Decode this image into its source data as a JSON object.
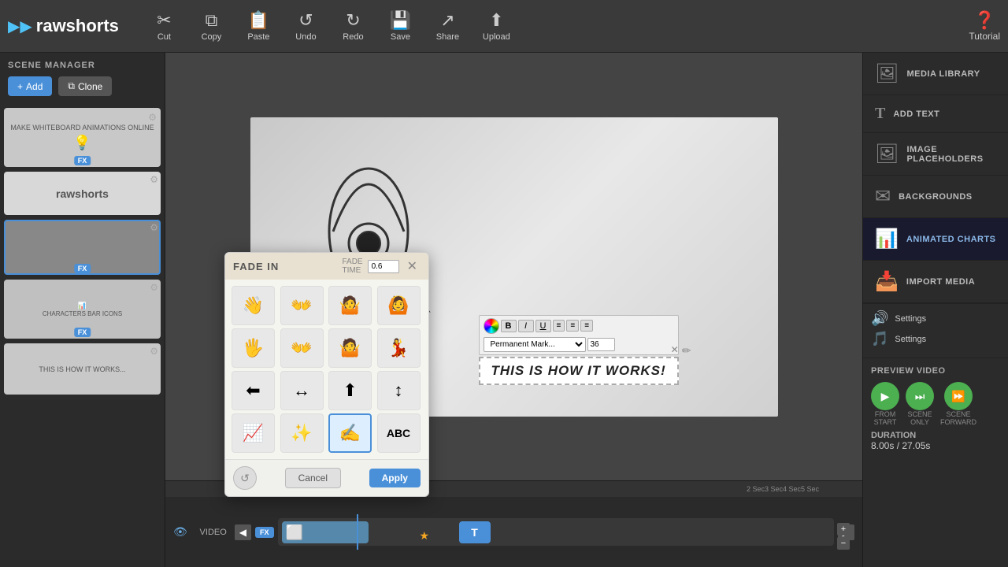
{
  "app": {
    "logo": "rawshorts",
    "logo_icon": "▶"
  },
  "toolbar": {
    "cut_label": "Cut",
    "copy_label": "Copy",
    "paste_label": "Paste",
    "undo_label": "Undo",
    "redo_label": "Redo",
    "save_label": "Save",
    "share_label": "Share",
    "upload_label": "Upload",
    "tutorial_label": "Tutorial"
  },
  "scene_manager": {
    "title": "SCENE MANAGER",
    "add_label": "Add",
    "clone_label": "Clone"
  },
  "right_sidebar": {
    "items": [
      {
        "id": "media-library",
        "label": "MEDIA LIBRARY",
        "icon": "🖼"
      },
      {
        "id": "add-text",
        "label": "ADD TEXT",
        "icon": "T"
      },
      {
        "id": "image-placeholders",
        "label": "IMAGE PLACEHOLDERS",
        "icon": "🖼"
      },
      {
        "id": "backgrounds",
        "label": "BACKGROUNDS",
        "icon": "✉"
      },
      {
        "id": "animated-charts",
        "label": "ANIMATED CHARTS",
        "icon": "📊"
      },
      {
        "id": "import-media",
        "label": "IMPORT MEDIA",
        "icon": "📥"
      }
    ]
  },
  "preview": {
    "title": "PREVIEW VIDEO",
    "from_start_label": "FROM\nSTART",
    "scene_only_label": "SCENE\nONLY",
    "scene_forward_label": "SCENE\nFORWARD",
    "duration_label": "DURATION",
    "duration_value": "8.00s / 27.05s"
  },
  "audio": {
    "settings_label": "Settings",
    "settings_label2": "Settings"
  },
  "modal": {
    "title": "FADE IN",
    "fade_time_label": "FADE\nTIME",
    "fade_time_value": "0.6",
    "cancel_label": "Cancel",
    "apply_label": "Apply",
    "animations": [
      {
        "icon": "👋",
        "id": "wave-hands-1"
      },
      {
        "icon": "👐",
        "id": "wave-hands-2"
      },
      {
        "icon": "🤷",
        "id": "person-shrug"
      },
      {
        "icon": "🙆",
        "id": "person-arms-up"
      },
      {
        "icon": "🖐",
        "id": "hand-dark-1"
      },
      {
        "icon": "👐",
        "id": "hands-dark"
      },
      {
        "icon": "🤷",
        "id": "person-dark-shrug"
      },
      {
        "icon": "💃",
        "id": "person-dark-2"
      },
      {
        "icon": "⬅",
        "id": "arrow-left"
      },
      {
        "icon": "↔",
        "id": "arrow-both"
      },
      {
        "icon": "⬆",
        "id": "arrow-up"
      },
      {
        "icon": "↕",
        "id": "arrow-up-down"
      },
      {
        "icon": "📈",
        "id": "chart-up"
      },
      {
        "icon": "✨",
        "id": "sparkle"
      },
      {
        "icon": "✍",
        "id": "pen-write"
      },
      {
        "icon": "ABC",
        "id": "text-abc"
      }
    ]
  },
  "timeline": {
    "marks": [
      "2 Sec",
      "3 Sec",
      "4 Sec",
      "5 Sec"
    ],
    "video_label": "VIDEO"
  },
  "text_overlay": {
    "content": "THIS IS HOW IT WORKS!",
    "font": "Permanent Mark...",
    "size": "36"
  }
}
